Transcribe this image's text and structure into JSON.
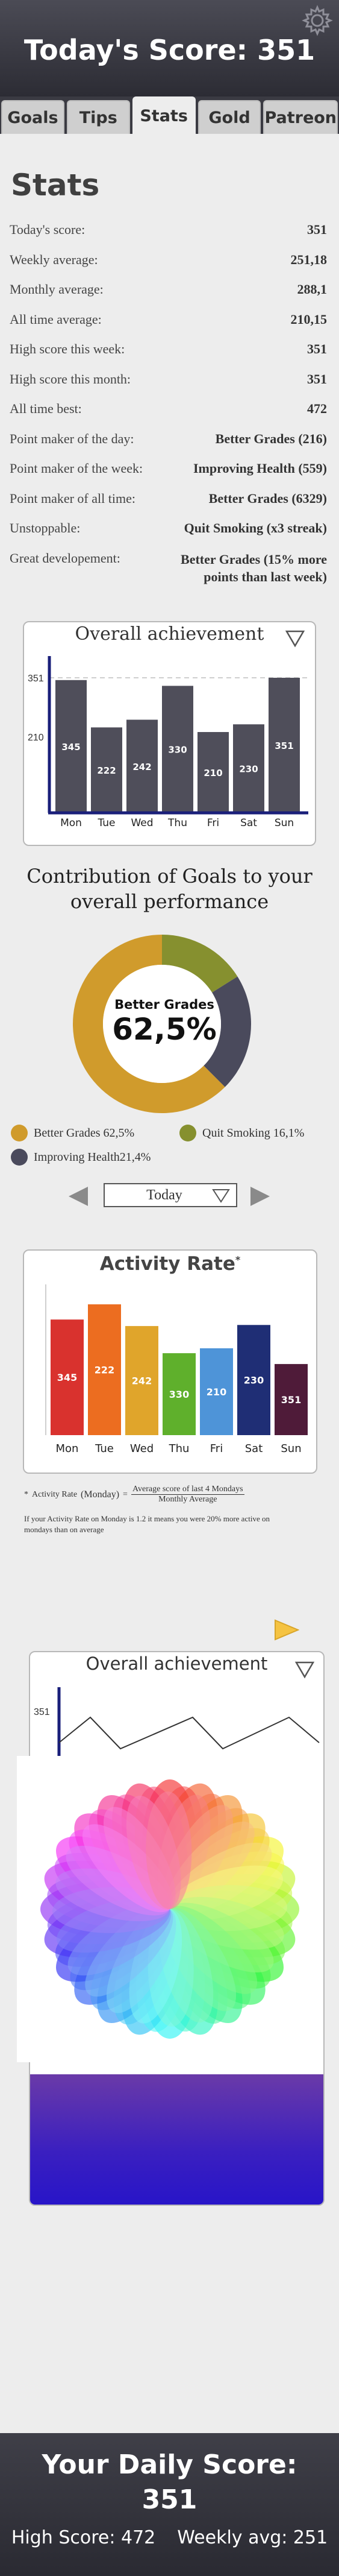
{
  "header": {
    "title": "Today's Score: 351",
    "settings_icon": "gear-icon"
  },
  "tabs": [
    {
      "label": "Goals",
      "active": false
    },
    {
      "label": "Tips",
      "active": false
    },
    {
      "label": "Stats",
      "active": true
    },
    {
      "label": "Gold",
      "active": false
    },
    {
      "label": "Patreon",
      "active": false
    }
  ],
  "stats": {
    "title": "Stats",
    "rows": [
      {
        "label": "Today's score:",
        "value": "351"
      },
      {
        "label": "Weekly average:",
        "value": "251,18"
      },
      {
        "label": "Monthly average:",
        "value": "288,1"
      },
      {
        "label": "All time average:",
        "value": "210,15"
      },
      {
        "label": "High score this week:",
        "value": "351"
      },
      {
        "label": "High score this month:",
        "value": "351"
      },
      {
        "label": "All time best:",
        "value": "472"
      },
      {
        "label": "Point maker of the day:",
        "value": "Better Grades (216)"
      },
      {
        "label": "Point maker of the week:",
        "value": "Improving Health (559)"
      },
      {
        "label": "Point maker of all time:",
        "value": "Better Grades (6329)"
      },
      {
        "label": "Unstoppable:",
        "value": "Quit Smoking (x3 streak)"
      },
      {
        "label": "Great developement:",
        "value": "Better Grades (15% more points than last week)"
      }
    ]
  },
  "overall_achievement": {
    "title": "Overall achievement",
    "ytick_top": "351",
    "ytick_mid": "210",
    "days": [
      "Mon",
      "Tue",
      "Wed",
      "Thu",
      "Fri",
      "Sat",
      "Sun"
    ],
    "values": [
      345,
      222,
      242,
      330,
      210,
      230,
      351
    ],
    "bar_color": "#4f4e5a"
  },
  "contribution": {
    "title_line1": "Contribution of Goals to your",
    "title_line2": "overall performance",
    "center_label": "Better Grades",
    "center_value": "62,5%",
    "legend": [
      {
        "label": "Better Grades 62,5%",
        "color": "#d09b2c"
      },
      {
        "label": "Quit Smoking 16,1%",
        "color": "#86902f"
      },
      {
        "label": "Improving Health21,4%",
        "color": "#4a4a5c"
      }
    ]
  },
  "period_selector": {
    "value": "Today"
  },
  "activity_rate": {
    "title": "Activity Rate",
    "title_mark": "*",
    "days": [
      "Mon",
      "Tue",
      "Wed",
      "Thu",
      "Fri",
      "Sat",
      "Sun"
    ],
    "values": [
      345,
      222,
      242,
      330,
      210,
      230,
      351
    ],
    "heights": [
      2.13,
      2.41,
      2.01,
      1.51,
      1.6,
      2.03,
      1.31
    ],
    "colors": [
      "#d9322e",
      "#ec6d20",
      "#e0a52b",
      "#5fb02c",
      "#4e94d8",
      "#1f2e75",
      "#4f1b39"
    ],
    "footnote_star": "*",
    "footnote_lhs": "Activity Rate",
    "footnote_paren": "(Monday)",
    "footnote_eq": "=",
    "footnote_num": "Average score of last 4 Mondays",
    "footnote_den": "Monthly Average",
    "footnote_text": "If your Activity Rate on Monday is 1.2 it means you were 20% more active on mondays than on average"
  },
  "overlay_card": {
    "title": "Overall achievement",
    "ytick": "351",
    "play_icon": "play-icon",
    "color_wheel_icon": "color-wheel-icon"
  },
  "footer": {
    "title_line1": "Your Daily Score:",
    "title_line2": "351",
    "high_score": "High Score: 472",
    "weekly_avg": "Weekly avg: 251"
  }
}
